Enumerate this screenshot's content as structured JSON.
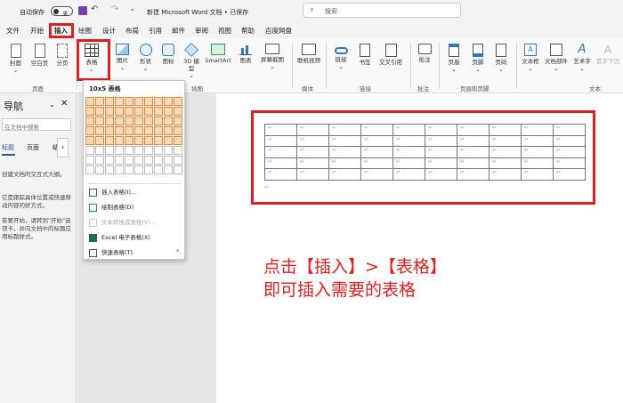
{
  "titlebar": {
    "autosave_label": "自动保存",
    "autosave_state": "关",
    "doc_title": "新建 Microsoft Word 文档 • 已保存",
    "search_placeholder": "搜索"
  },
  "menu": [
    "文件",
    "开始",
    "插入",
    "绘图",
    "设计",
    "布局",
    "引用",
    "邮件",
    "审阅",
    "视图",
    "帮助",
    "百度网盘"
  ],
  "ribbon": {
    "buttons": {
      "cover": "封面",
      "blank": "空白页",
      "pagebreak": "分页",
      "table": "表格",
      "picture": "图片",
      "shapes": "形状",
      "icons": "图标",
      "model3d": "3D 模型",
      "smartart": "SmartArt",
      "chart": "图表",
      "screenshot": "屏幕截图",
      "online_video": "联机视频",
      "link": "链接",
      "bookmark": "书签",
      "crossref": "交叉引用",
      "comment": "批注",
      "header": "页眉",
      "footer": "页脚",
      "pagenum": "页码",
      "textbox": "文本框",
      "quickparts": "文档部件",
      "wordart": "艺术字",
      "dropcap": "首字下沉"
    },
    "groups": {
      "pages": "页面",
      "illustrations": "插图",
      "media": "媒体",
      "links": "链接",
      "comments": "批注",
      "header_footer": "页眉和页脚",
      "text": "文本"
    }
  },
  "nav": {
    "title": "导航",
    "search_placeholder": "在文档中搜索",
    "tabs": [
      "标题",
      "页面",
      "结"
    ],
    "p1": "创建文档的交互式大纲。",
    "p2": "它是跟踪具体位置或快速移动内容的好方式。",
    "p3": "若要开始，请转到\"开始\"选项卡，并向文档中的标题应用标题样式。"
  },
  "dropdown": {
    "header": "10x5 表格",
    "selected_cols": 10,
    "selected_rows": 5,
    "items": [
      "插入表格(I)...",
      "绘制表格(D)",
      "文本转换成表格(V)...",
      "Excel 电子表格(X)",
      "快速表格(T)"
    ]
  },
  "doc_table": {
    "rows": 5,
    "cols": 10,
    "cell_mark": "↵"
  },
  "paragraph_mark": "↵",
  "caption": {
    "line1": "点击【插入】>【表格】",
    "line2": "即可插入需要的表格"
  },
  "colors": {
    "accent_red": "#e02020",
    "word_blue": "#2b579a"
  }
}
